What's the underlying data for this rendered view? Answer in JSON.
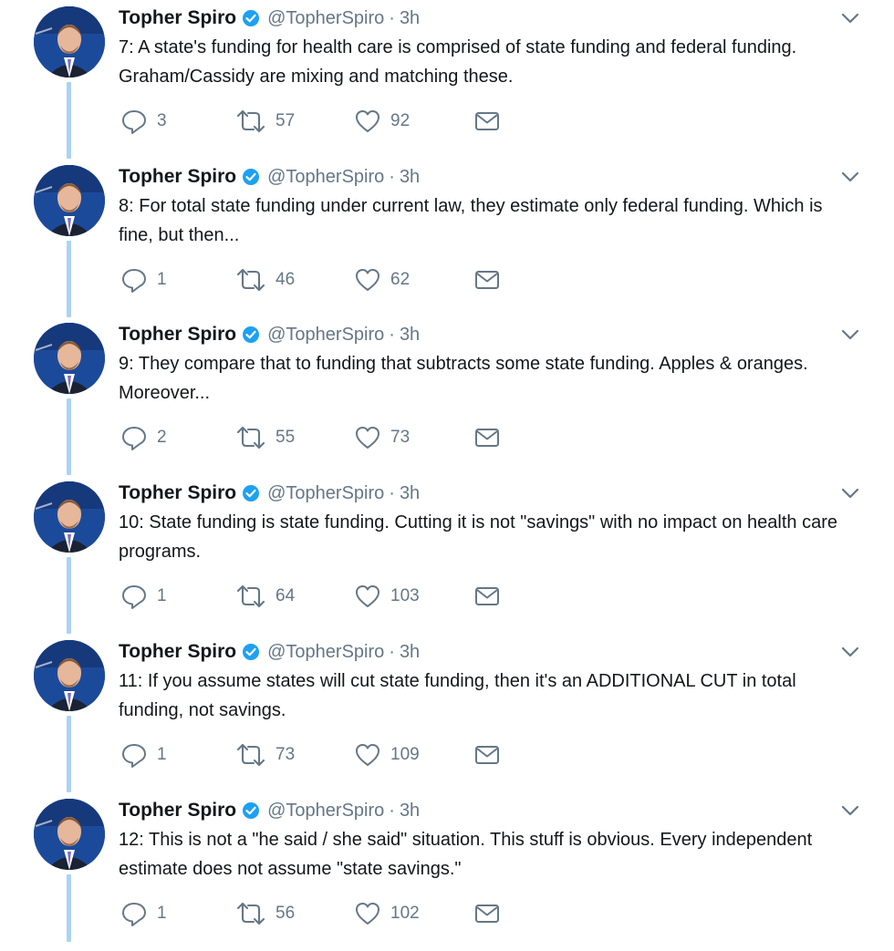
{
  "colors": {
    "thread_line": "#a9d3f5",
    "verified_badge": "#1da1f2",
    "secondary_text": "#657786",
    "icon_gray": "#657786",
    "name_text": "#14171a"
  },
  "icons": {
    "reply": "speech-bubble",
    "retweet": "retweet-arrows",
    "like": "heart-outline",
    "dm": "envelope",
    "more": "chevron-down",
    "verified": "blue-check-badge"
  },
  "tweets": [
    {
      "name": "Topher Spiro",
      "handle": "@TopherSpiro",
      "separator": "·",
      "time": "3h",
      "text": "7: A state's funding for health care is comprised of state funding and federal funding. Graham/Cassidy are mixing and matching these.",
      "replies": "3",
      "retweets": "57",
      "likes": "92"
    },
    {
      "name": "Topher Spiro",
      "handle": "@TopherSpiro",
      "separator": "·",
      "time": "3h",
      "text": "8: For total state funding under current law, they estimate only federal funding. Which is fine, but then...",
      "replies": "1",
      "retweets": "46",
      "likes": "62"
    },
    {
      "name": "Topher Spiro",
      "handle": "@TopherSpiro",
      "separator": "·",
      "time": "3h",
      "text": "9: They compare that to funding that subtracts some state funding. Apples & oranges. Moreover...",
      "replies": "2",
      "retweets": "55",
      "likes": "73"
    },
    {
      "name": "Topher Spiro",
      "handle": "@TopherSpiro",
      "separator": "·",
      "time": "3h",
      "text": "10: State funding is state funding. Cutting it is not \"savings\" with no impact on health care programs.",
      "replies": "1",
      "retweets": "64",
      "likes": "103"
    },
    {
      "name": "Topher Spiro",
      "handle": "@TopherSpiro",
      "separator": "·",
      "time": "3h",
      "text": "11: If you assume states will cut state funding, then it's an ADDITIONAL CUT in total funding, not savings.",
      "replies": "1",
      "retweets": "73",
      "likes": "109"
    },
    {
      "name": "Topher Spiro",
      "handle": "@TopherSpiro",
      "separator": "·",
      "time": "3h",
      "text": "12: This is not a \"he said / she said\" situation. This stuff is obvious. Every independent estimate does not assume \"state savings.\"",
      "replies": "1",
      "retweets": "56",
      "likes": "102"
    }
  ]
}
